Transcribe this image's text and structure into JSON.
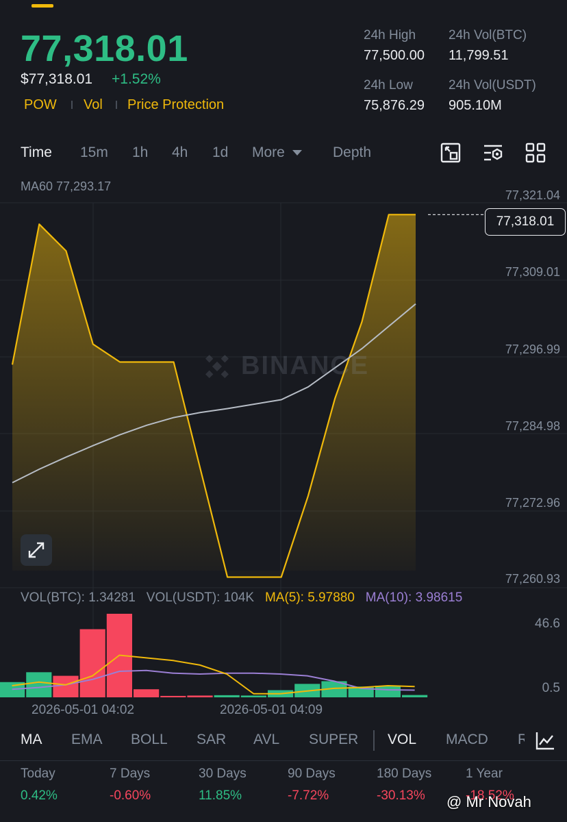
{
  "header": {
    "price": "77,318.01",
    "price_usd": "$77,318.01",
    "change_pct": "+1.52%",
    "tags": [
      "POW",
      "Vol",
      "Price Protection"
    ],
    "stats": {
      "high_label": "24h High",
      "high_value": "77,500.00",
      "vol_btc_label": "24h Vol(BTC)",
      "vol_btc_value": "11,799.51",
      "low_label": "24h Low",
      "low_value": "75,876.29",
      "vol_usdt_label": "24h Vol(USDT)",
      "vol_usdt_value": "905.10M"
    }
  },
  "toolbar": {
    "timeframes": [
      "Time",
      "15m",
      "1h",
      "4h",
      "1d"
    ],
    "more_label": "More",
    "depth_label": "Depth",
    "icons": [
      "chart-settings-icon",
      "indicator-settings-icon",
      "grid-layout-icon"
    ]
  },
  "chart": {
    "ma60_label": "MA60 77,293.17",
    "y_labels": [
      "77,321.04",
      "77,309.01",
      "77,296.99",
      "77,284.98",
      "77,272.96",
      "77,260.93"
    ],
    "current_price_tag": "77,318.01",
    "watermark": "BINANCE"
  },
  "volume": {
    "vol_btc": "VOL(BTC): 1.34281",
    "vol_usdt": "VOL(USDT): 104K",
    "ma5": "MA(5): 5.97880",
    "ma10": "MA(10): 3.98615",
    "y_max": "46.6",
    "y_min": "0.5",
    "x_labels": [
      "2026-05-01 04:02",
      "2026-05-01 04:09"
    ]
  },
  "indicators": {
    "main": [
      "MA",
      "EMA",
      "BOLL",
      "SAR",
      "AVL",
      "SUPER"
    ],
    "sub": [
      "VOL",
      "MACD",
      "R"
    ]
  },
  "performance": [
    {
      "label": "Today",
      "value": "0.42%"
    },
    {
      "label": "7 Days",
      "value": "-0.60%"
    },
    {
      "label": "30 Days",
      "value": "11.85%"
    },
    {
      "label": "90 Days",
      "value": "-7.72%"
    },
    {
      "label": "180 Days",
      "value": "-30.13%"
    },
    {
      "label": "1 Year",
      "value": "-18.52%"
    }
  ],
  "credit": "@ Mr Novah",
  "colors": {
    "up": "#2ebd85",
    "down": "#f6465d",
    "accent": "#f0b90b",
    "ma10": "#9b7fd4",
    "ma60": "#b7bdc6"
  },
  "chart_data": {
    "type": "area",
    "y_unit": "price (USDT)",
    "ylim": [
      77260.93,
      77321.04
    ],
    "price": [
      77294.5,
      77316.5,
      77312.3,
      77297.7,
      77294.9,
      77294.9,
      77294.9,
      77278.0,
      77261.2,
      77261.2,
      77261.2,
      77273.9,
      77289.2,
      77301.2,
      77318.0,
      77318.0
    ],
    "ma60": [
      77276.0,
      77278.1,
      77280.0,
      77281.8,
      77283.5,
      77285.0,
      77286.2,
      77287.0,
      77287.6,
      77288.3,
      77289.0,
      77291.0,
      77294.0,
      77297.0,
      77300.5,
      77304.0
    ],
    "volume": {
      "ylim": [
        0,
        46.6
      ],
      "values": [
        8.5,
        14.0,
        12.0,
        38.0,
        46.6,
        4.5,
        0.8,
        1.0,
        1.2,
        1.0,
        4.0,
        7.5,
        9.0,
        6.0,
        6.5,
        1.3
      ],
      "direction": [
        "up",
        "up",
        "down",
        "down",
        "down",
        "down",
        "down",
        "down",
        "up",
        "up",
        "up",
        "up",
        "up",
        "up",
        "up",
        "up"
      ],
      "ma5": [
        6.5,
        8.5,
        7.0,
        12.0,
        23.5,
        22.0,
        20.5,
        18.0,
        13.0,
        2.0,
        2.0,
        3.5,
        5.0,
        5.5,
        6.5,
        6.0
      ],
      "ma10": [
        4.5,
        5.5,
        7.0,
        10.0,
        14.5,
        15.0,
        13.5,
        13.0,
        13.5,
        13.5,
        13.0,
        12.0,
        9.0,
        5.0,
        4.2,
        4.0
      ]
    }
  }
}
